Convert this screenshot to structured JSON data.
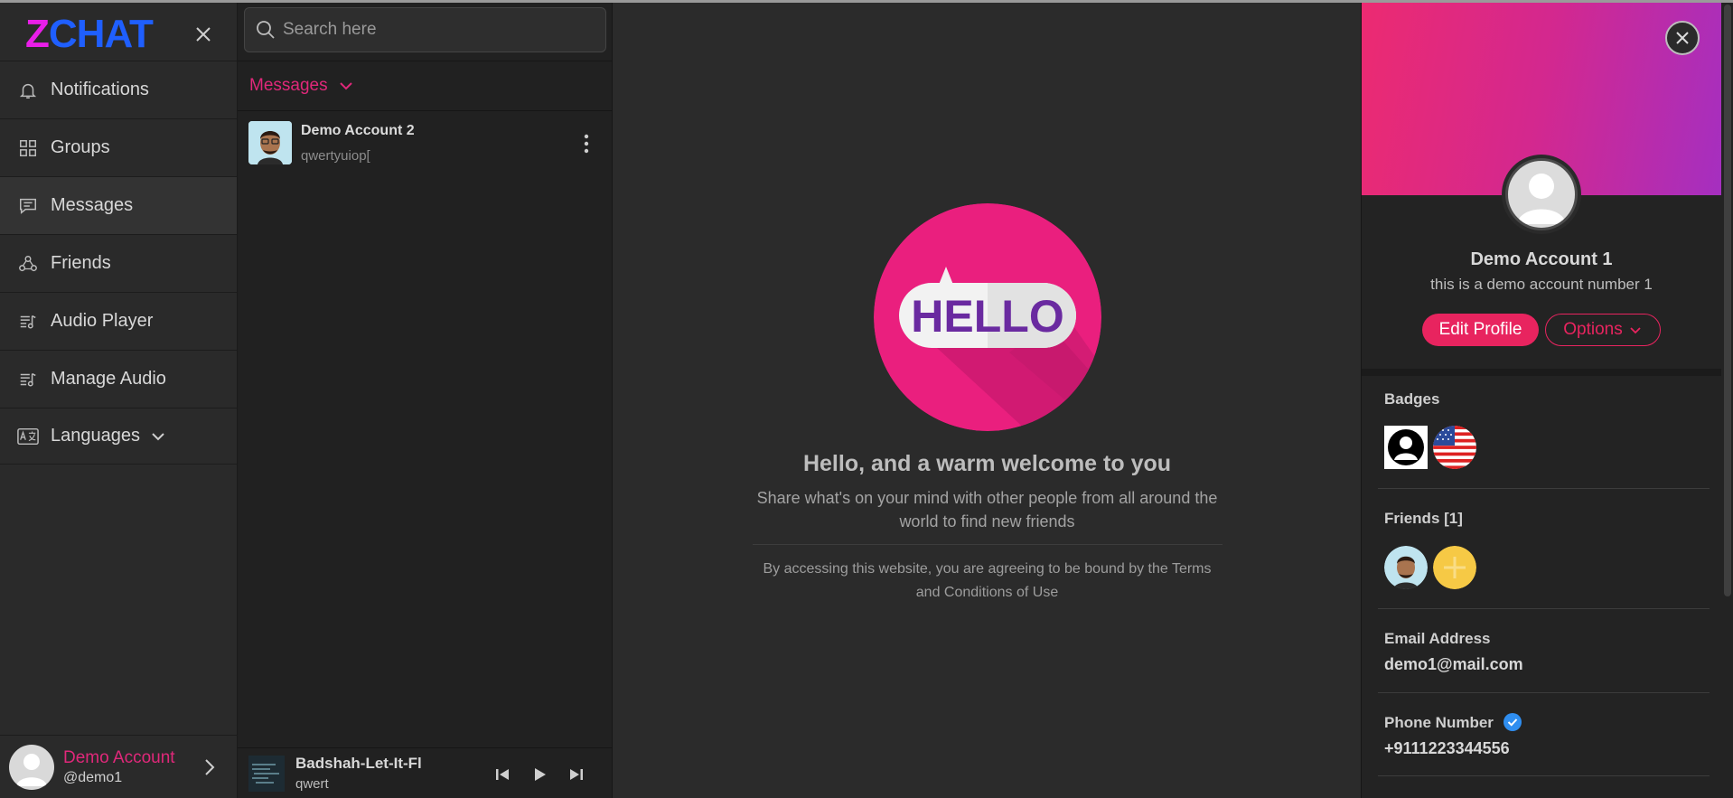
{
  "brand": {
    "logo_z": "Z",
    "logo_rest": "CHAT"
  },
  "sidebar": {
    "items": [
      {
        "label": "Notifications",
        "icon": "bell-icon"
      },
      {
        "label": "Groups",
        "icon": "grid-icon"
      },
      {
        "label": "Messages",
        "icon": "chat-icon",
        "active": true
      },
      {
        "label": "Friends",
        "icon": "friends-icon"
      },
      {
        "label": "Audio Player",
        "icon": "playlist-icon"
      },
      {
        "label": "Manage Audio",
        "icon": "playlist-icon"
      },
      {
        "label": "Languages",
        "icon": "translate-icon"
      }
    ],
    "user": {
      "name": "Demo Account",
      "handle": "@demo1"
    }
  },
  "messages": {
    "search_placeholder": "Search here",
    "header": "Messages",
    "chats": [
      {
        "name": "Demo Account 2",
        "preview": "qwertyuiop["
      }
    ]
  },
  "player": {
    "title": "Badshah-Let-It-Fl",
    "artist": "qwert"
  },
  "welcome": {
    "image_text": "HELLO",
    "title": "Hello, and a warm welcome to you",
    "subtitle": "Share what's on your mind with other people from all around the world to find new friends",
    "terms": "By accessing this website, you are agreeing to be bound by the Terms and Conditions of Use"
  },
  "profile": {
    "name": "Demo Account 1",
    "bio": "this is a demo account number 1",
    "edit_label": "Edit Profile",
    "options_label": "Options",
    "badges_title": "Badges",
    "friends_title": "Friends [1]",
    "email_title": "Email Address",
    "email": "demo1@mail.com",
    "phone_title": "Phone Number",
    "phone": "+9111223344556"
  },
  "colors": {
    "accent": "#e0287a",
    "brand_blue": "#1f5fff",
    "brand_pink": "#e91ee8"
  }
}
